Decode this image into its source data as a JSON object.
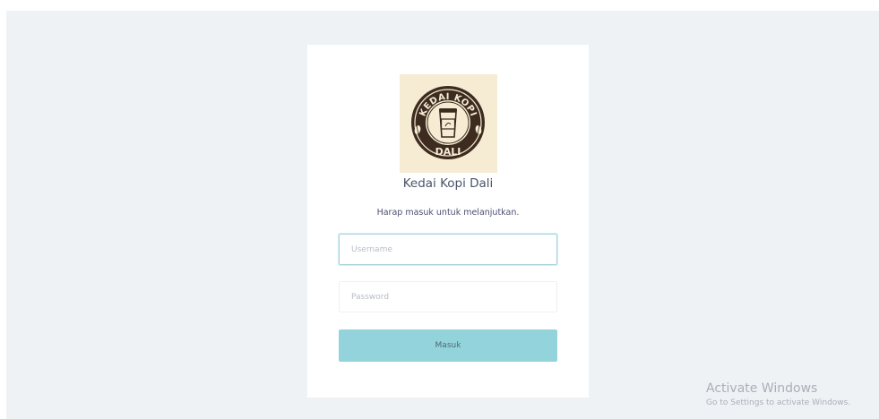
{
  "brand": {
    "logo_text_top": "KEDAI KOPI",
    "logo_text_bottom": "DALI",
    "name": "Kedai Kopi Dali"
  },
  "login": {
    "subtitle": "Harap masuk untuk melanjutkan.",
    "username_placeholder": "Username",
    "password_placeholder": "Password",
    "submit_label": "Masuk"
  },
  "watermark": {
    "title": "Activate Windows",
    "subtitle": "Go to Settings to activate Windows."
  },
  "colors": {
    "background": "#eff2f5",
    "button": "#93d3dc",
    "logo_dark": "#3d2b1f",
    "logo_cream": "#f5ecd3"
  }
}
